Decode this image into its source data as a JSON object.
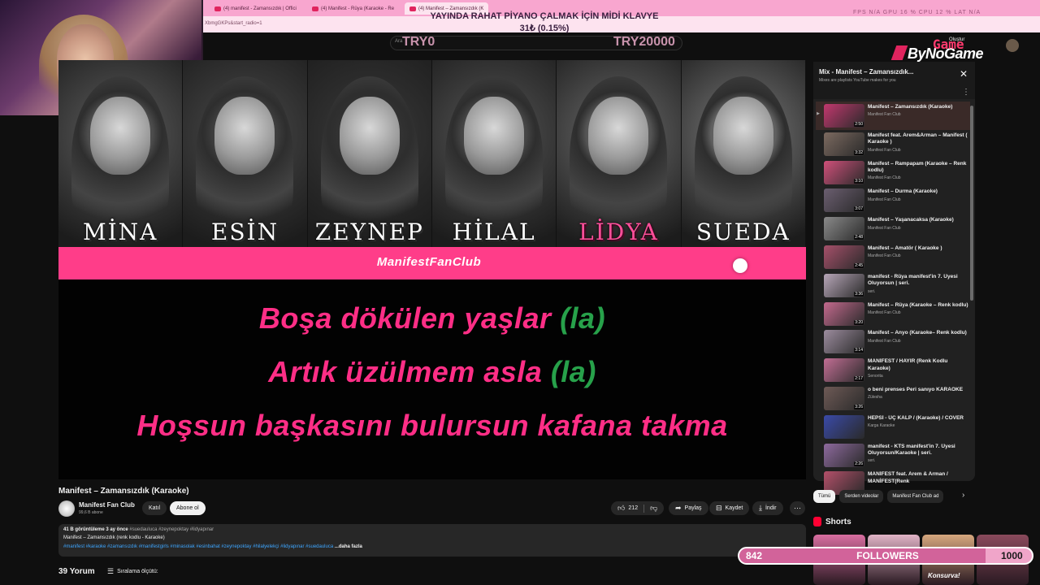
{
  "browser": {
    "tabs": [
      {
        "label": "(4) manifest - Zamansızdık | Offici"
      },
      {
        "label": "(4) Manifest - Rüya (Karaoke - Re"
      },
      {
        "label": "(4) Manifest – Zamansızdık (K"
      }
    ],
    "address": "XbmgGKPs&start_radio=1"
  },
  "overlay": {
    "donation_title": "YAYINDA RAHAT PİYANO ÇALMAK İÇİN MİDİ KLAVYE",
    "donation_amount": "31₺ (0.15%)",
    "goal_left": "TRY0",
    "goal_right": "TRY20000",
    "stats": "FPS N/A    GPU 16 %    CPU 12 %    LAT N/A",
    "brand": "ByNoGame",
    "game_tag": "Game",
    "followers": {
      "current": "842",
      "label": "FOLLOWERS",
      "goal": "1000",
      "progress": 0.842
    }
  },
  "youtube": {
    "search_hint": "Ara",
    "create_label": "Oluştur",
    "video": {
      "members": [
        {
          "name": "MİNA",
          "highlight": false
        },
        {
          "name": "ESİN",
          "highlight": false
        },
        {
          "name": "ZEYNEP",
          "highlight": false
        },
        {
          "name": "HİLAL",
          "highlight": false
        },
        {
          "name": "LİDYA",
          "highlight": true
        },
        {
          "name": "SUEDA",
          "highlight": false
        }
      ],
      "band_text": "ManifestFanClub",
      "lyrics": [
        {
          "text": "Boşa dökülen yaşlar ",
          "green": "(la)"
        },
        {
          "text": "Artık üzülmem asla ",
          "green": "(la)"
        },
        {
          "text": "Hoşsun başkasını bulursun kafana takma",
          "green": ""
        }
      ]
    },
    "title": "Manifest – Zamansızdık (Karaoke)",
    "channel": {
      "name": "Manifest Fan Club",
      "subs": "99,6 B abone",
      "join": "Katıl",
      "subscribe": "Abone ol"
    },
    "actions": {
      "likes": "212",
      "share": "Paylaş",
      "save": "Kaydet",
      "download": "İndir"
    },
    "description": {
      "meta": "41 B görüntüleme  3 ay önce",
      "tags_top": "#suedaulucа #zeynepoktay #lidyapınar",
      "subtitle": "Manifest – Zamansızdık (renk kodlu - Karaoke)",
      "hashtags": "#manifest #karaoke #zamansızdık #manifestgirls #minasolak #esinbahat #zeynepoktay #hilalyelekçi #lidyapınar #suedaulucа",
      "more": "...daha fazla"
    },
    "comments": {
      "count": "39 Yorum",
      "sort": "Sıralama ölçütü:"
    },
    "playlist": {
      "title": "Mix - Manifest – Zamansızdık...",
      "subtitle": "Mixes are playlists YouTube makes for you",
      "items": [
        {
          "title": "Manifest – Zamansızdık (Karaoke)",
          "channel": "Manifest Fan Club",
          "duration": "2:50",
          "color": "#c2386e"
        },
        {
          "title": "Manifest feat. Arem&Arman – Manifest ( Karaoke )",
          "channel": "Manifest Fan Club",
          "duration": "3:32",
          "color": "#7c6a60"
        },
        {
          "title": "Manifest – Rampapam (Karaoke – Renk kodlu)",
          "channel": "Manifest Fan Club",
          "duration": "3:10",
          "color": "#d0507a"
        },
        {
          "title": "Manifest – Durma (Karaoke)",
          "channel": "Manifest Fan Club",
          "duration": "3:07",
          "color": "#6b5e70"
        },
        {
          "title": "Manifest – Yaşanacaksa (Karaoke)",
          "channel": "Manifest Fan Club",
          "duration": "2:48",
          "color": "#8a8a8a"
        },
        {
          "title": "Manifest – Amatör ( Karaoke )",
          "channel": "Manifest Fan Club",
          "duration": "2:45",
          "color": "#a6506a"
        },
        {
          "title": "manifest - Rüya manifest'in 7. Üyesi Oluyorsun | seri.",
          "channel": "seri.",
          "duration": "3:36",
          "color": "#b7a6b8"
        },
        {
          "title": "Manifest – Rüya (Karaoke – Renk kodlu)",
          "channel": "Manifest Fan Club",
          "duration": "3:20",
          "color": "#c46a8e"
        },
        {
          "title": "Manifest – Anyo (Karaoke– Renk kodlu)",
          "channel": "Manifest Fan Club",
          "duration": "3:14",
          "color": "#9c8c9e"
        },
        {
          "title": "MANİFEST / HAYIR (Renk Kodlu Karaoke)",
          "channel": "Senorita",
          "duration": "2:17",
          "color": "#c26e94"
        },
        {
          "title": "o beni prenses Peri sanıyo KARAOKE",
          "channel": "Zülesha",
          "duration": "3:26",
          "color": "#6e5a56"
        },
        {
          "title": "HEPSİ - ÜÇ KALP / (Karaoke) / COVER",
          "channel": "Karga Karaoke",
          "duration": "",
          "color": "#3a4aa8"
        },
        {
          "title": "manifest - KTS manifest'in 7. Üyesi Oluyorsun/Karaoke | seri.",
          "channel": "seri.",
          "duration": "2:26",
          "color": "#8e6a9e"
        },
        {
          "title": "MANİFEST feat. Arem & Arman / MANİFEST(Renk",
          "channel": "",
          "duration": "",
          "color": "#b4506a"
        }
      ]
    },
    "chips": [
      "Tümü",
      "Serden videolar",
      "Manifest Fan Club ad"
    ],
    "shorts_label": "Shorts",
    "shorts_colors": [
      "#d86ea0",
      "#e0b3c6",
      "#d6a77e",
      "#8a4a5c"
    ],
    "shorts_caption": "Konsurva!"
  }
}
